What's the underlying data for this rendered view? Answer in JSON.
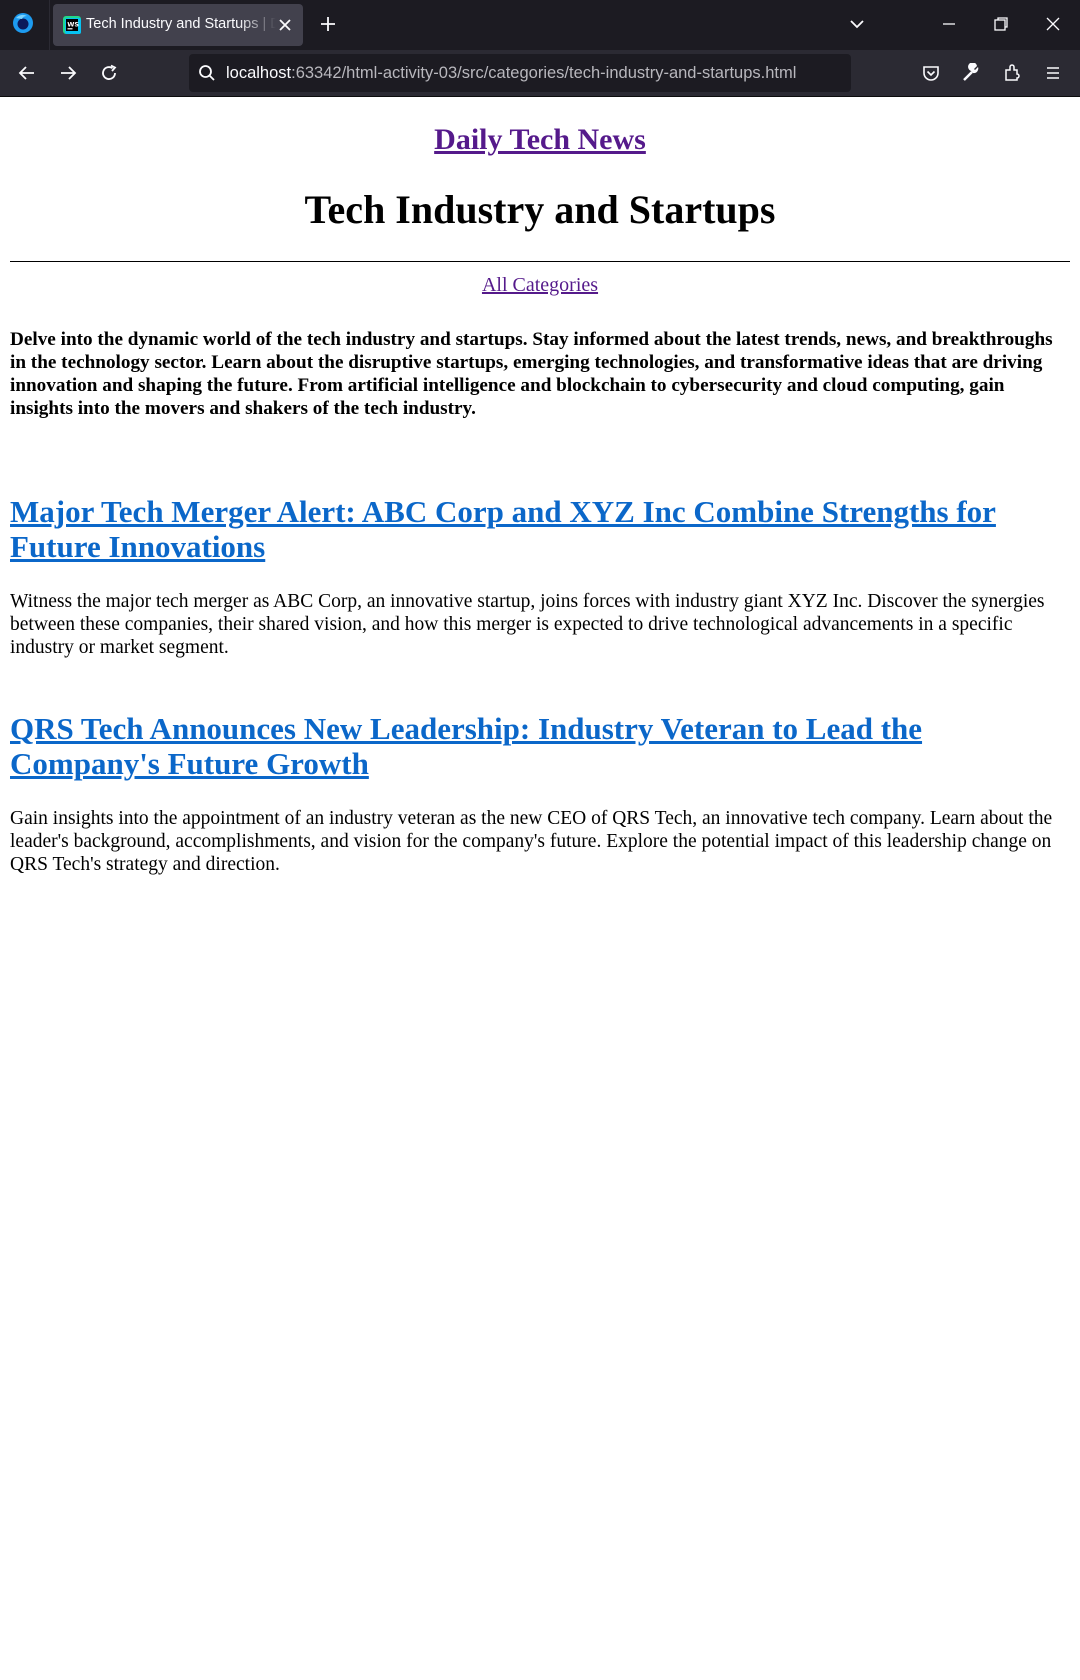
{
  "browser": {
    "tab_title": "Tech Industry and Startups | Daily Tech News",
    "url_host": "localhost",
    "url_rest": ":63342/html-activity-03/src/categories/tech-industry-and-startups.html"
  },
  "page": {
    "site_title": "Daily Tech News",
    "heading": "Tech Industry and Startups",
    "categories_link": "All Categories",
    "intro": "Delve into the dynamic world of the tech industry and startups. Stay informed about the latest trends, news, and breakthroughs in the technology sector. Learn about the disruptive startups, emerging technologies, and transformative ideas that are driving innovation and shaping the future. From artificial intelligence and blockchain to cybersecurity and cloud computing, gain insights into the movers and shakers of the tech industry.",
    "articles": [
      {
        "title": "Major Tech Merger Alert: ABC Corp and XYZ Inc Combine Strengths for Future Innovations",
        "body": "Witness the major tech merger as ABC Corp, an innovative startup, joins forces with industry giant XYZ Inc. Discover the synergies between these companies, their shared vision, and how this merger is expected to drive technological advancements in a specific industry or market segment."
      },
      {
        "title": "QRS Tech Announces New Leadership: Industry Veteran to Lead the Company's Future Growth",
        "body": "Gain insights into the appointment of an industry veteran as the new CEO of QRS Tech, an innovative tech company. Learn about the leader's background, accomplishments, and vision for the company's future. Explore the potential impact of this leadership change on QRS Tech's strategy and direction."
      }
    ]
  },
  "colors": {
    "visited_link": "#551a8b",
    "article_link": "#0b67c9",
    "chrome_dark": "#1c1b22",
    "chrome_toolbar": "#2b2a33"
  },
  "icons": [
    "firefox-logo-icon",
    "webstorm-favicon-icon",
    "close-icon",
    "plus-icon",
    "chevron-down-icon",
    "minimize-icon",
    "restore-icon",
    "back-arrow-icon",
    "forward-arrow-icon",
    "reload-icon",
    "search-icon",
    "pocket-icon",
    "wrench-icon",
    "extensions-icon",
    "hamburger-menu-icon"
  ]
}
